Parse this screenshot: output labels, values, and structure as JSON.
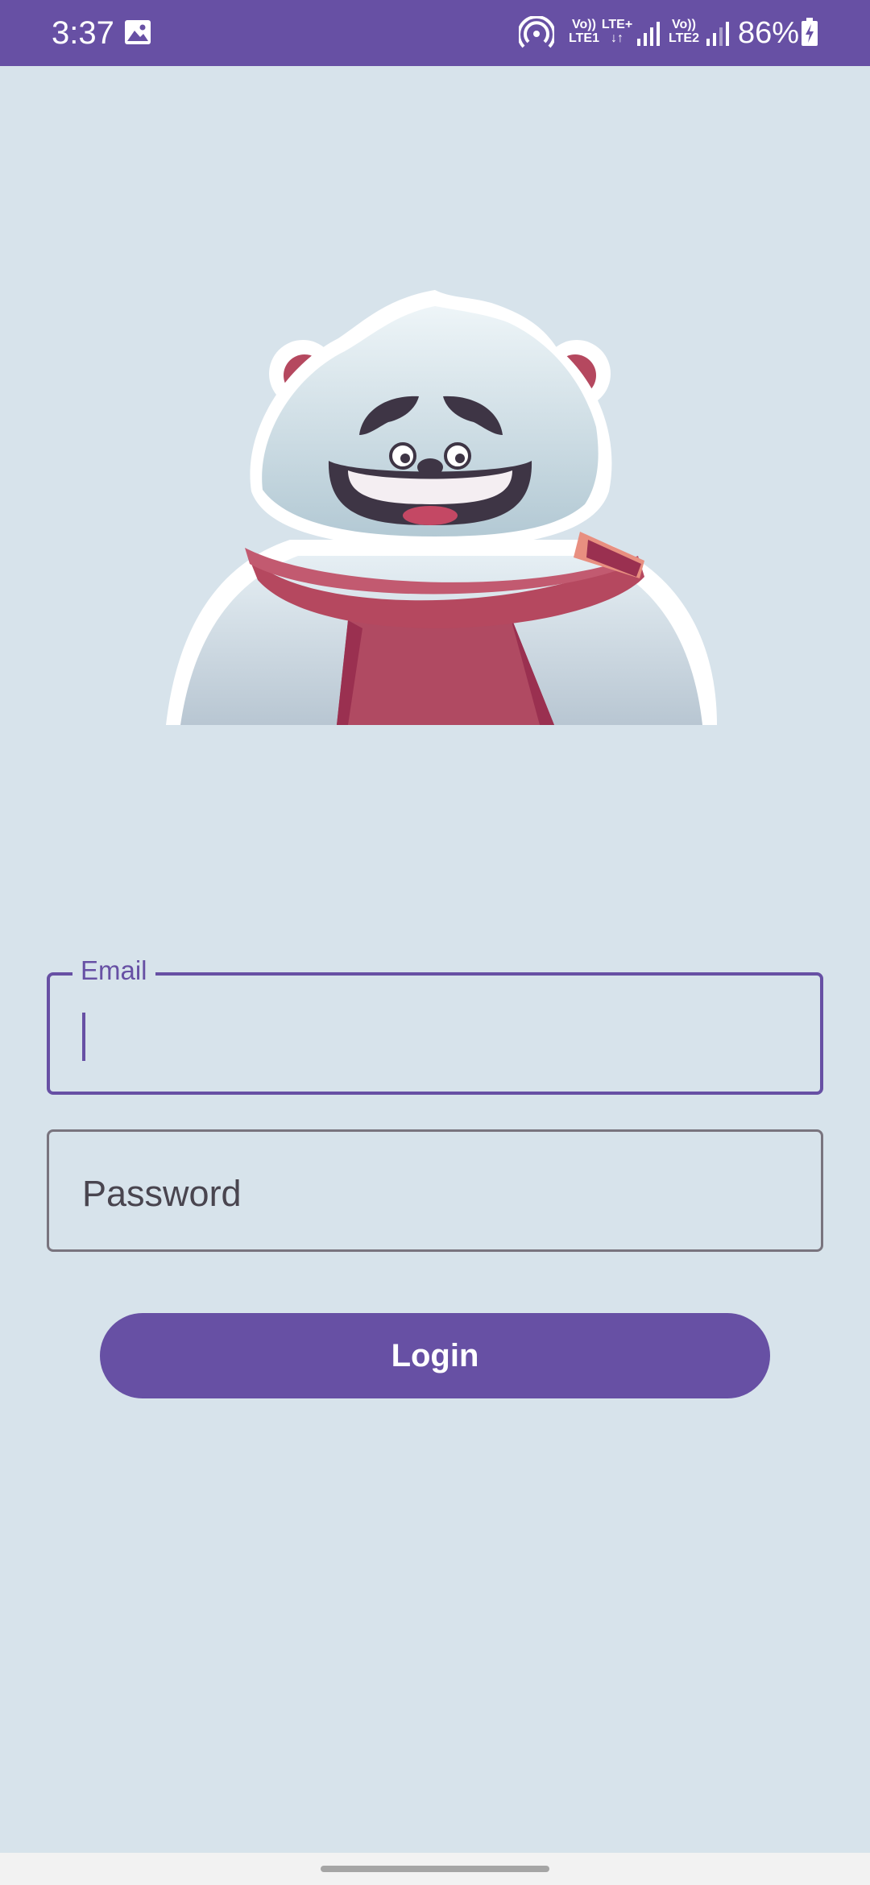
{
  "status_bar": {
    "time": "3:37",
    "network": {
      "sim1_top": "Vo))",
      "sim1_bottom": "LTE1",
      "data_top": "LTE+",
      "data_bottom": "↓↑",
      "sim2_top": "Vo))",
      "sim2_bottom": "LTE2"
    },
    "battery": "86%",
    "icons": [
      "gallery-icon",
      "hotspot-icon",
      "signal-icon",
      "battery-charging-icon"
    ]
  },
  "login": {
    "email_label": "Email",
    "password_placeholder": "Password",
    "button_label": "Login"
  },
  "colors": {
    "primary": "#6750a4",
    "background": "#d7e3eb",
    "outline": "#79747e"
  }
}
